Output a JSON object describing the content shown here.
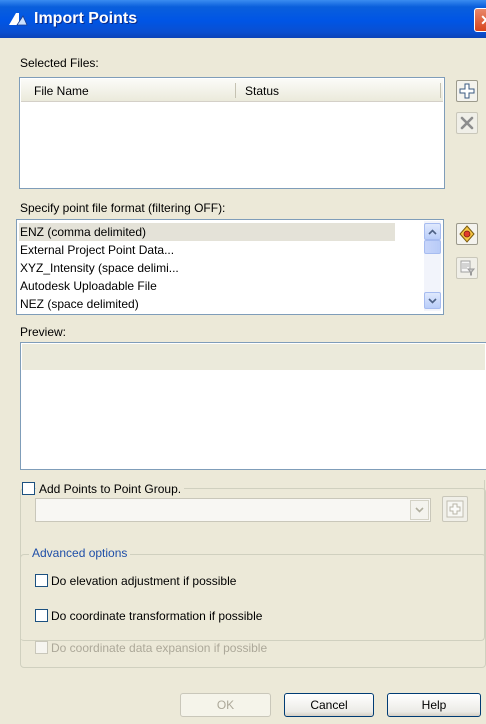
{
  "window": {
    "title": "Import Points",
    "close_glyph": "✕"
  },
  "selected_files": {
    "label": "Selected Files:",
    "columns": [
      "File Name",
      "Status"
    ]
  },
  "format": {
    "label": "Specify point file format (filtering OFF):",
    "items": [
      "ENZ (comma delimited)",
      "External Project Point Data...",
      "XYZ_Intensity (space delimi...",
      "Autodesk Uploadable File",
      "NEZ (space delimited)"
    ],
    "selected_index": 0
  },
  "preview": {
    "label": "Preview:"
  },
  "point_group": {
    "checkbox_label": "Add Points to Point Group.",
    "checked": false,
    "combo_value": ""
  },
  "advanced": {
    "title": "Advanced options",
    "options": [
      {
        "label": "Do elevation adjustment if possible",
        "checked": false,
        "enabled": true
      },
      {
        "label": "Do coordinate transformation if possible",
        "checked": false,
        "enabled": true
      },
      {
        "label": "Do coordinate data expansion if possible",
        "checked": false,
        "enabled": false
      }
    ]
  },
  "buttons": {
    "ok": "OK",
    "cancel": "Cancel",
    "help": "Help"
  }
}
